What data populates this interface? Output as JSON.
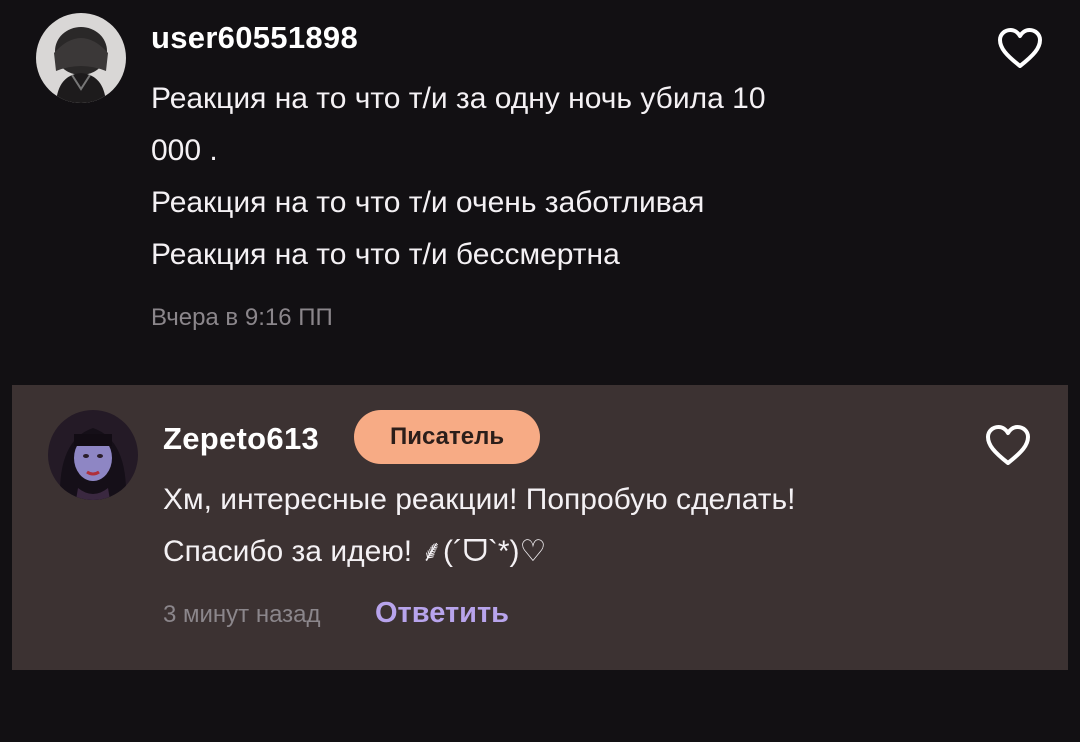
{
  "comments": [
    {
      "username": "user60551898",
      "avatar_icon": "user-photo-avatar",
      "text_lines": [
        "Реакция на то что т/и за одну ночь убила 10",
        "000 .",
        "Реакция на то что т/и очень заботливая",
        "Реакция на то что т/и бессмертна"
      ],
      "timestamp": "Вчера в 9:16 ПП",
      "like_icon": "heart-outline-icon"
    },
    {
      "username": "Zepeto613",
      "badge": "Писатель",
      "avatar_icon": "user-photo-avatar",
      "text_lines": [
        "Хм, интересные реакции! Попробую сделать!",
        "Спасибо за идею! ⸙(´ᗜ`*)♡"
      ],
      "timestamp": "3 минут назад",
      "reply_label": "Ответить",
      "like_icon": "heart-outline-icon"
    }
  ],
  "colors": {
    "background": "#121013",
    "highlight_background": "#3c3232",
    "badge_background": "#f7ab85",
    "reply_link": "#b8a4ec",
    "timestamp": "#8b868b"
  }
}
